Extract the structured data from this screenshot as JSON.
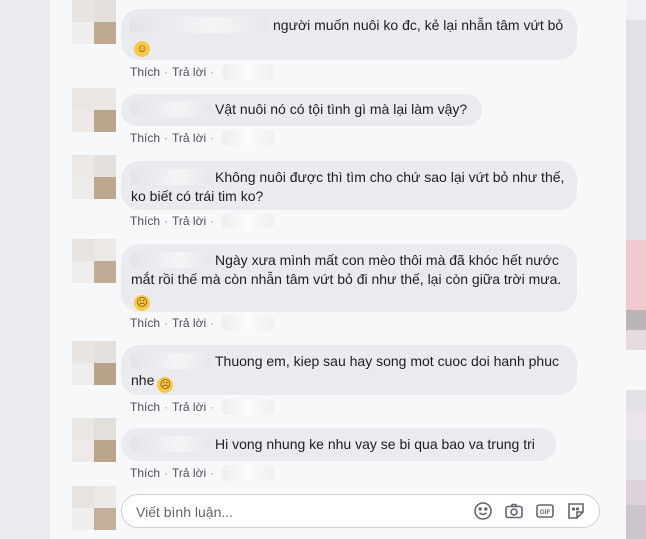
{
  "comments": [
    {
      "name_redacted": true,
      "text": "người muốn nuôi ko đc, kẻ lại nhẫn tâm vứt bỏ",
      "emoji": "slightly-smiling-emoji",
      "like_label": "Thích",
      "reply_label": "Trả lời"
    },
    {
      "name_redacted": true,
      "text": "Vật nuôi nó có tội tình gì mà lại làm vậy?",
      "like_label": "Thích",
      "reply_label": "Trả lời"
    },
    {
      "name_redacted": true,
      "text": "Không nuôi được thì tìm cho chứ sao lại vứt bỏ như thế, ko biết có trái tim ko?",
      "like_label": "Thích",
      "reply_label": "Trả lời"
    },
    {
      "name_redacted": true,
      "text": "Ngày xưa mình mất con mèo thôi mà đã khóc hết nước mắt rồi thế mà còn nhẫn tâm vứt bỏ đi như thế, lại còn giữa trời mưa.",
      "emoji": "sad-emoji",
      "like_label": "Thích",
      "reply_label": "Trả lời"
    },
    {
      "name_redacted": true,
      "text": "Thuong em, kiep sau hay song mot cuoc doi hanh phuc nhe",
      "emoji": "sad-emoji",
      "like_label": "Thích",
      "reply_label": "Trả lời"
    },
    {
      "name_redacted": true,
      "text": "Hi vong nhung ke nhu vay se bi qua bao va trung tri",
      "like_label": "Thích",
      "reply_label": "Trả lời"
    }
  ],
  "composer": {
    "placeholder": "Viết bình luận...",
    "icons": [
      "emoji-icon",
      "camera-icon",
      "gif-icon",
      "sticker-icon"
    ]
  },
  "colors": {
    "bubble_bg": "#e9ebee",
    "action_text": "#606770",
    "page_bg": "#f7f8fa"
  }
}
